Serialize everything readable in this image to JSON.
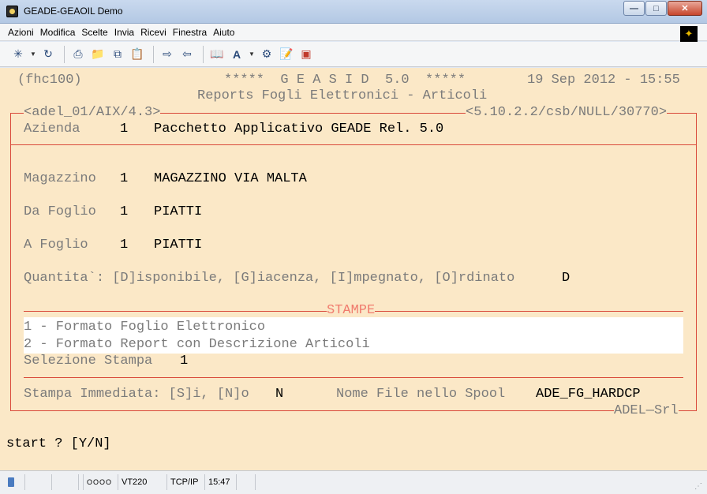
{
  "window": {
    "title": "GEADE-GEAOIL Demo"
  },
  "menu": [
    "Azioni",
    "Modifica",
    "Scelte",
    "Invia",
    "Ricevi",
    "Finestra",
    "Aiuto"
  ],
  "toolbar": {
    "icons": [
      "new-session-icon",
      "connect-icon",
      "print-icon",
      "open-folder-icon",
      "copy-icon",
      "paste-icon",
      "transfer-send-icon",
      "transfer-receive-icon",
      "book-icon",
      "font-icon",
      "settings-icon",
      "notepad-icon",
      "screen-icon"
    ]
  },
  "terminal": {
    "prog_code": "(fhc100)",
    "header": "*****  G E A S I D  5.0  *****",
    "date": "19 Sep 2012 - 15:55",
    "subtitle": "Reports Fogli Elettronici - Articoli",
    "host_left": "<adel_01/AIX/4.3>",
    "host_right": "<5.10.2.2/csb/NULL/30770>",
    "azienda": {
      "label": "Azienda",
      "code": "1",
      "desc": "Pacchetto Applicativo GEADE Rel. 5.0"
    },
    "magazzino": {
      "label": "Magazzino",
      "code": "1",
      "desc": "MAGAZZINO VIA MALTA"
    },
    "da_foglio": {
      "label": "Da Foglio",
      "code": "1",
      "desc": "PIATTI"
    },
    "a_foglio": {
      "label": "A Foglio",
      "code": "1",
      "desc": "PIATTI"
    },
    "quantita": {
      "label": "Quantita`: [D]isponibile, [G]iacenza, [I]mpegnato, [O]rdinato",
      "value": "D"
    },
    "stampe_label": "STAMPE",
    "options": [
      "1 - Formato Foglio Elettronico",
      "2 - Formato Report con Descrizione Articoli"
    ],
    "selezione": {
      "label": "Selezione Stampa",
      "value": "1"
    },
    "immediata": {
      "label": "Stampa Immediata: [S]i, [N]o",
      "value": "N"
    },
    "spool": {
      "label": "Nome File nello Spool",
      "value": "ADE_FG_HARDCP"
    },
    "footer_brand": "ADEL—Srl",
    "prompt": "start ? [Y/N]"
  },
  "statusbar": {
    "indicator": "OOOO",
    "emulation": "VT220",
    "protocol": "TCP/IP",
    "time": "15:47"
  }
}
